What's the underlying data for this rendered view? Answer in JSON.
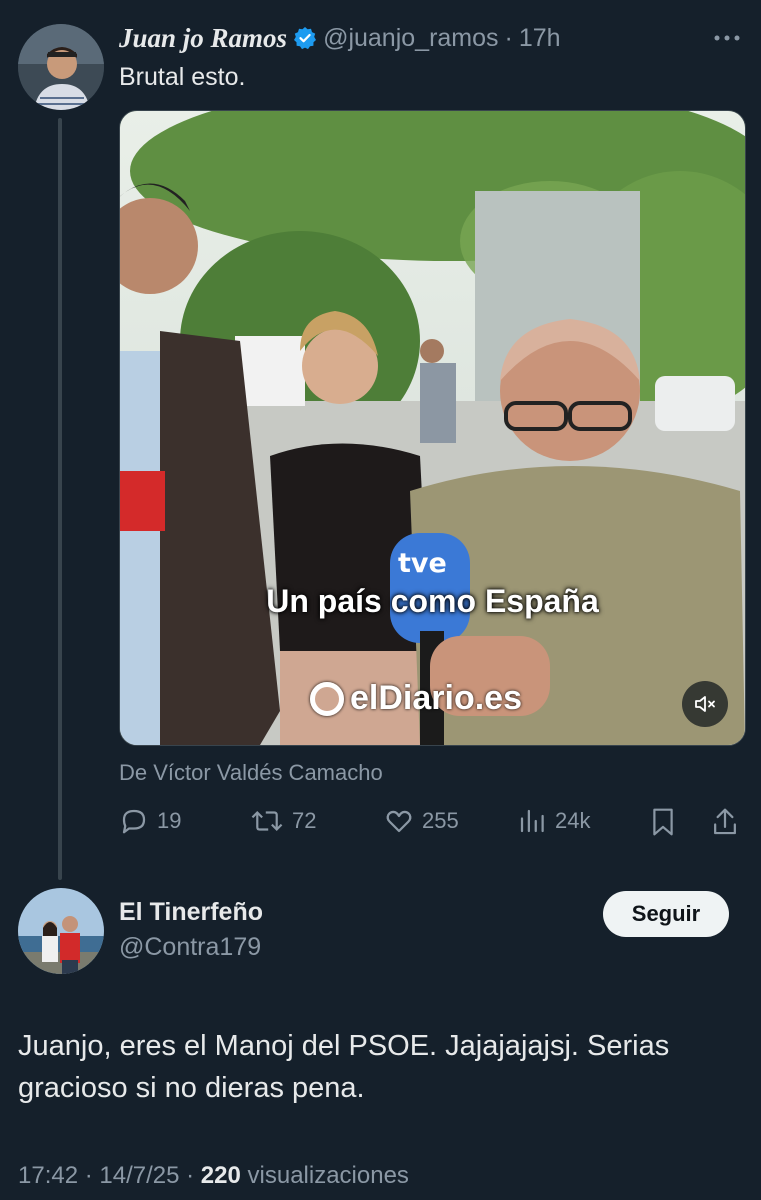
{
  "tweet": {
    "author_name": "Juan jo Ramos",
    "handle": "@juanjo_ramos",
    "time": "17h",
    "text": "Brutal esto.",
    "media": {
      "caption": "Un país como España",
      "watermark": "elDiario.es",
      "mic_label": "tve"
    },
    "attribution": "De Víctor Valdés Camacho",
    "actions": {
      "replies": "19",
      "retweets": "72",
      "likes": "255",
      "views": "24k"
    }
  },
  "reply": {
    "author_name": "El Tinerfeño",
    "handle": "@Contra179",
    "follow_label": "Seguir",
    "text": "Juanjo, eres el Manoj del PSOE. Jajajajajsj. Serias gracioso si no dieras pena.",
    "timestamp": "17:42 · 14/7/25 · ",
    "views_count": "220",
    "views_label": "visualizaciones"
  },
  "colors": {
    "background": "#15202b",
    "verified": "#1d9bf0",
    "follow_button": "#eff3f4"
  }
}
